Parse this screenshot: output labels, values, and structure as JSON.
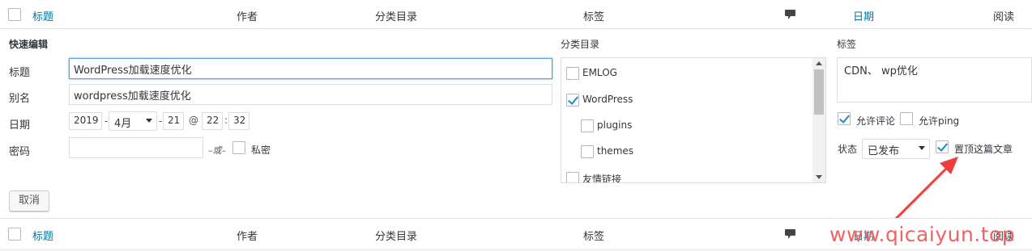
{
  "table_header": {
    "title": "标题",
    "author": "作者",
    "categories": "分类目录",
    "tags": "标签",
    "comments_icon": "comment-icon",
    "date": "日期",
    "views": "阅读"
  },
  "quick_edit": {
    "heading": "快速编辑",
    "title_label": "标题",
    "title_value": "WordPress加载速度优化",
    "slug_label": "别名",
    "slug_value": "wordpress加载速度优化",
    "date_label": "日期",
    "year": "2019",
    "dash1": "-",
    "month": "4月",
    "dash2": "-",
    "day": "21",
    "at": "@",
    "hour": "22",
    "colon": ":",
    "minute": "32",
    "password_label": "密码",
    "password_value": "",
    "or_text": "–或–",
    "private_label": "私密",
    "cancel_button": "取消"
  },
  "categories_panel": {
    "label": "分类目录",
    "items": [
      {
        "name": "EMLOG",
        "checked": false
      },
      {
        "name": "WordPress",
        "checked": true
      },
      {
        "name": "plugins",
        "checked": false
      },
      {
        "name": "themes",
        "checked": false
      },
      {
        "name": "友情链接",
        "checked": false
      }
    ]
  },
  "tags_panel": {
    "label": "标签",
    "value": "CDN、 wp优化",
    "allow_comments": "允许评论",
    "allow_ping": "允许ping",
    "status_label": "状态",
    "status_value": "已发布",
    "sticky_label": "置顶这篇文章"
  },
  "watermark": "www.qicaiyun.top",
  "colors": {
    "link": "#0073aa",
    "focus_border": "#5b9dd9",
    "check": "#1e8cbe",
    "annotation": "#f03c3c"
  }
}
